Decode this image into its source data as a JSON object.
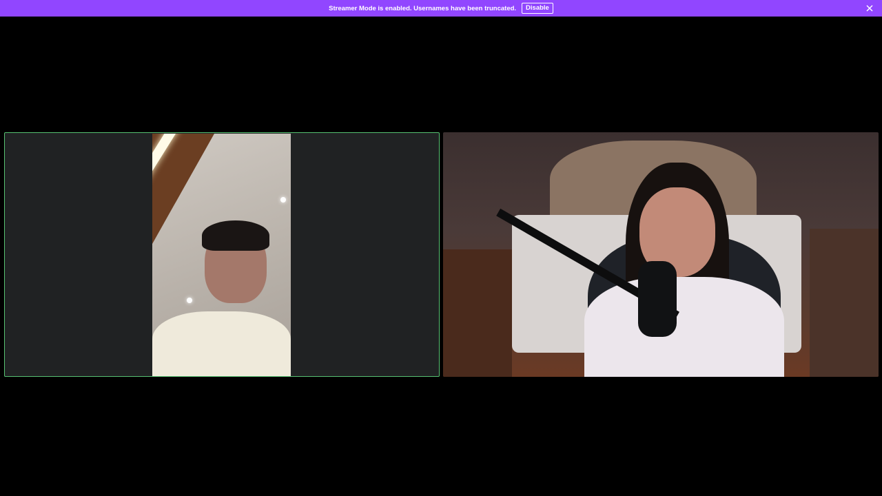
{
  "banner": {
    "message": "Streamer Mode is enabled. Usernames have been truncated.",
    "disable_label": "Disable",
    "background_color": "#9146ff"
  },
  "participants": [
    {
      "position": "left",
      "active_speaker": true,
      "highlight_color": "#57c272"
    },
    {
      "position": "right",
      "active_speaker": false
    }
  ],
  "icons": {
    "close": "close-icon"
  }
}
